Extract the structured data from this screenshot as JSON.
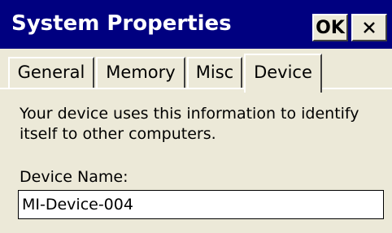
{
  "window": {
    "title": "System Properties",
    "ok_label": "OK",
    "close_icon": "close-icon"
  },
  "tabs": [
    {
      "label": "General",
      "active": false
    },
    {
      "label": "Memory",
      "active": false
    },
    {
      "label": "Misc",
      "active": false
    },
    {
      "label": "Device",
      "active": true
    }
  ],
  "device": {
    "description": "Your device uses this information to identify itself to other computers.",
    "name_label": "Device Name:",
    "name_value": "MI-Device-004"
  },
  "colors": {
    "titlebar": "#000080",
    "face": "#ece9d8"
  }
}
